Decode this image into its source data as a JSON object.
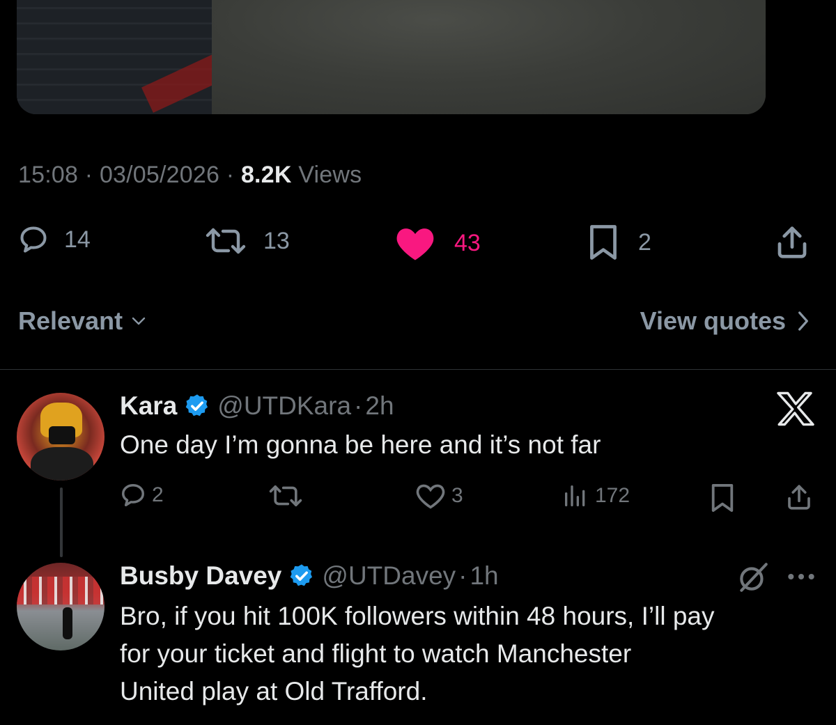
{
  "tweet": {
    "time": "15:08",
    "date": "03/05/2026",
    "views_count": "8.2K",
    "views_label": "Views",
    "sep": "·",
    "actions": {
      "replies": "14",
      "reposts": "13",
      "likes": "43",
      "bookmarks": "2"
    },
    "like_color": "#f91880"
  },
  "sort": {
    "label": "Relevant",
    "view_quotes": "View quotes"
  },
  "replies": [
    {
      "name": "Kara",
      "handle": "@UTDKara",
      "age": "2h",
      "text": "One day I’m gonna be here and it’s not far",
      "actions": {
        "replies": "2",
        "reposts": "",
        "likes": "3",
        "views": "172"
      }
    },
    {
      "name": "Busby Davey",
      "handle": "@UTDavey",
      "age": "1h",
      "text_lines": [
        "Bro, if you hit 100K followers within 48 hours, I’ll pay",
        "for your ticket and flight to watch Manchester",
        "United play at Old Trafford."
      ]
    }
  ],
  "colors": {
    "verified": "#1d9bf0",
    "muted": "#71767b"
  }
}
